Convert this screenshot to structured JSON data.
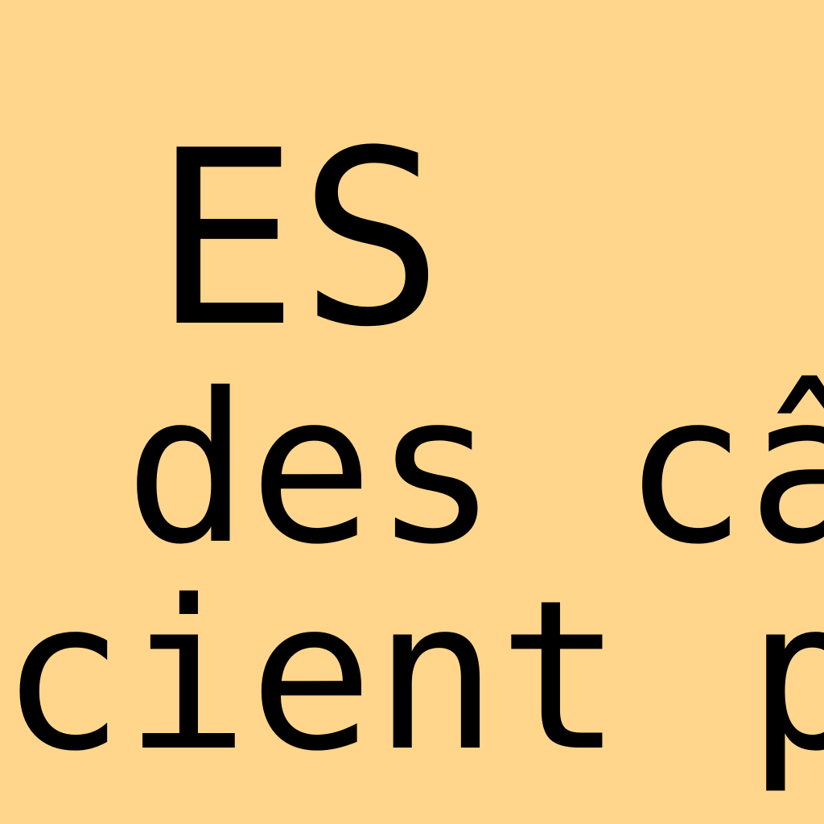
{
  "screen": {
    "background": "#FFD68C",
    "text_color": "#000000",
    "lines": [
      " ES",
      " des câb",
      "cient p"
    ]
  }
}
